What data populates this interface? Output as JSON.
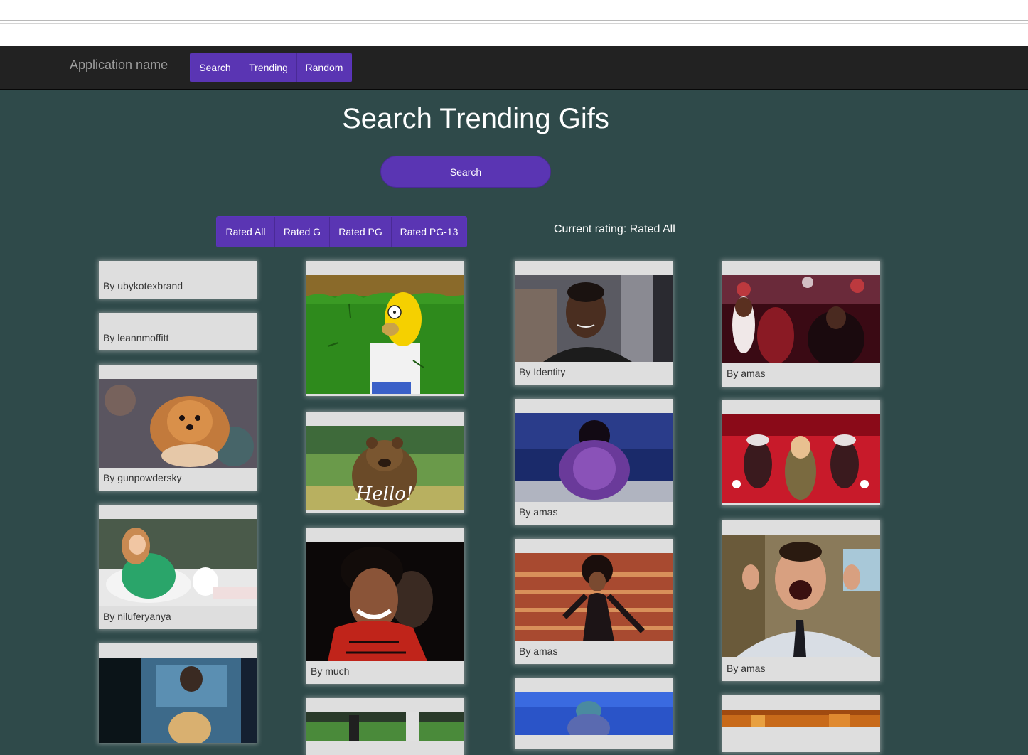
{
  "navbar": {
    "brand": "Application name",
    "buttons": [
      "Search",
      "Trending",
      "Random"
    ]
  },
  "page": {
    "title": "Search Trending Gifs",
    "search_button": "Search",
    "ratings": [
      "Rated All",
      "Rated G",
      "Rated PG",
      "Rated PG-13"
    ],
    "current_rating": "Current rating: Rated All"
  },
  "gifs": {
    "c1": [
      {
        "author": "By ubykotexbrand",
        "image": "none"
      },
      {
        "author": "By leannmoffitt",
        "image": "none"
      },
      {
        "author": "By gunpowdersky",
        "image": "pomeranian-dog"
      },
      {
        "author": "By niluferyanya",
        "image": "woman-in-bathtub-with-dog"
      },
      {
        "author": "",
        "image": "man-with-puppy"
      }
    ],
    "c2": [
      {
        "author": "",
        "image": "homer-simpson-backing-into-bushes"
      },
      {
        "author": "",
        "image": "bear-saying-hello",
        "overlay_text": "Hello!"
      },
      {
        "author": "By much",
        "image": "michael-jackson-smiling"
      },
      {
        "author": "",
        "image": "soccer-clip"
      }
    ],
    "c3": [
      {
        "author": "By Identity",
        "image": "man-smirking"
      },
      {
        "author": "By amas",
        "image": "performer-purple-outfit"
      },
      {
        "author": "By amas",
        "image": "singer-on-stage-stairs"
      },
      {
        "author": "",
        "image": "performer-blue-stage"
      }
    ],
    "c4": [
      {
        "author": "By amas",
        "image": "crowd-dancing"
      },
      {
        "author": "",
        "image": "dancers-red-stage"
      },
      {
        "author": "By amas",
        "image": "man-laughing-excited"
      },
      {
        "author": "",
        "image": "orange-scene"
      }
    ]
  },
  "colors": {
    "accent": "#5a35b3",
    "background": "#2f4a4a",
    "navbar": "#222222",
    "card": "#dedede"
  }
}
